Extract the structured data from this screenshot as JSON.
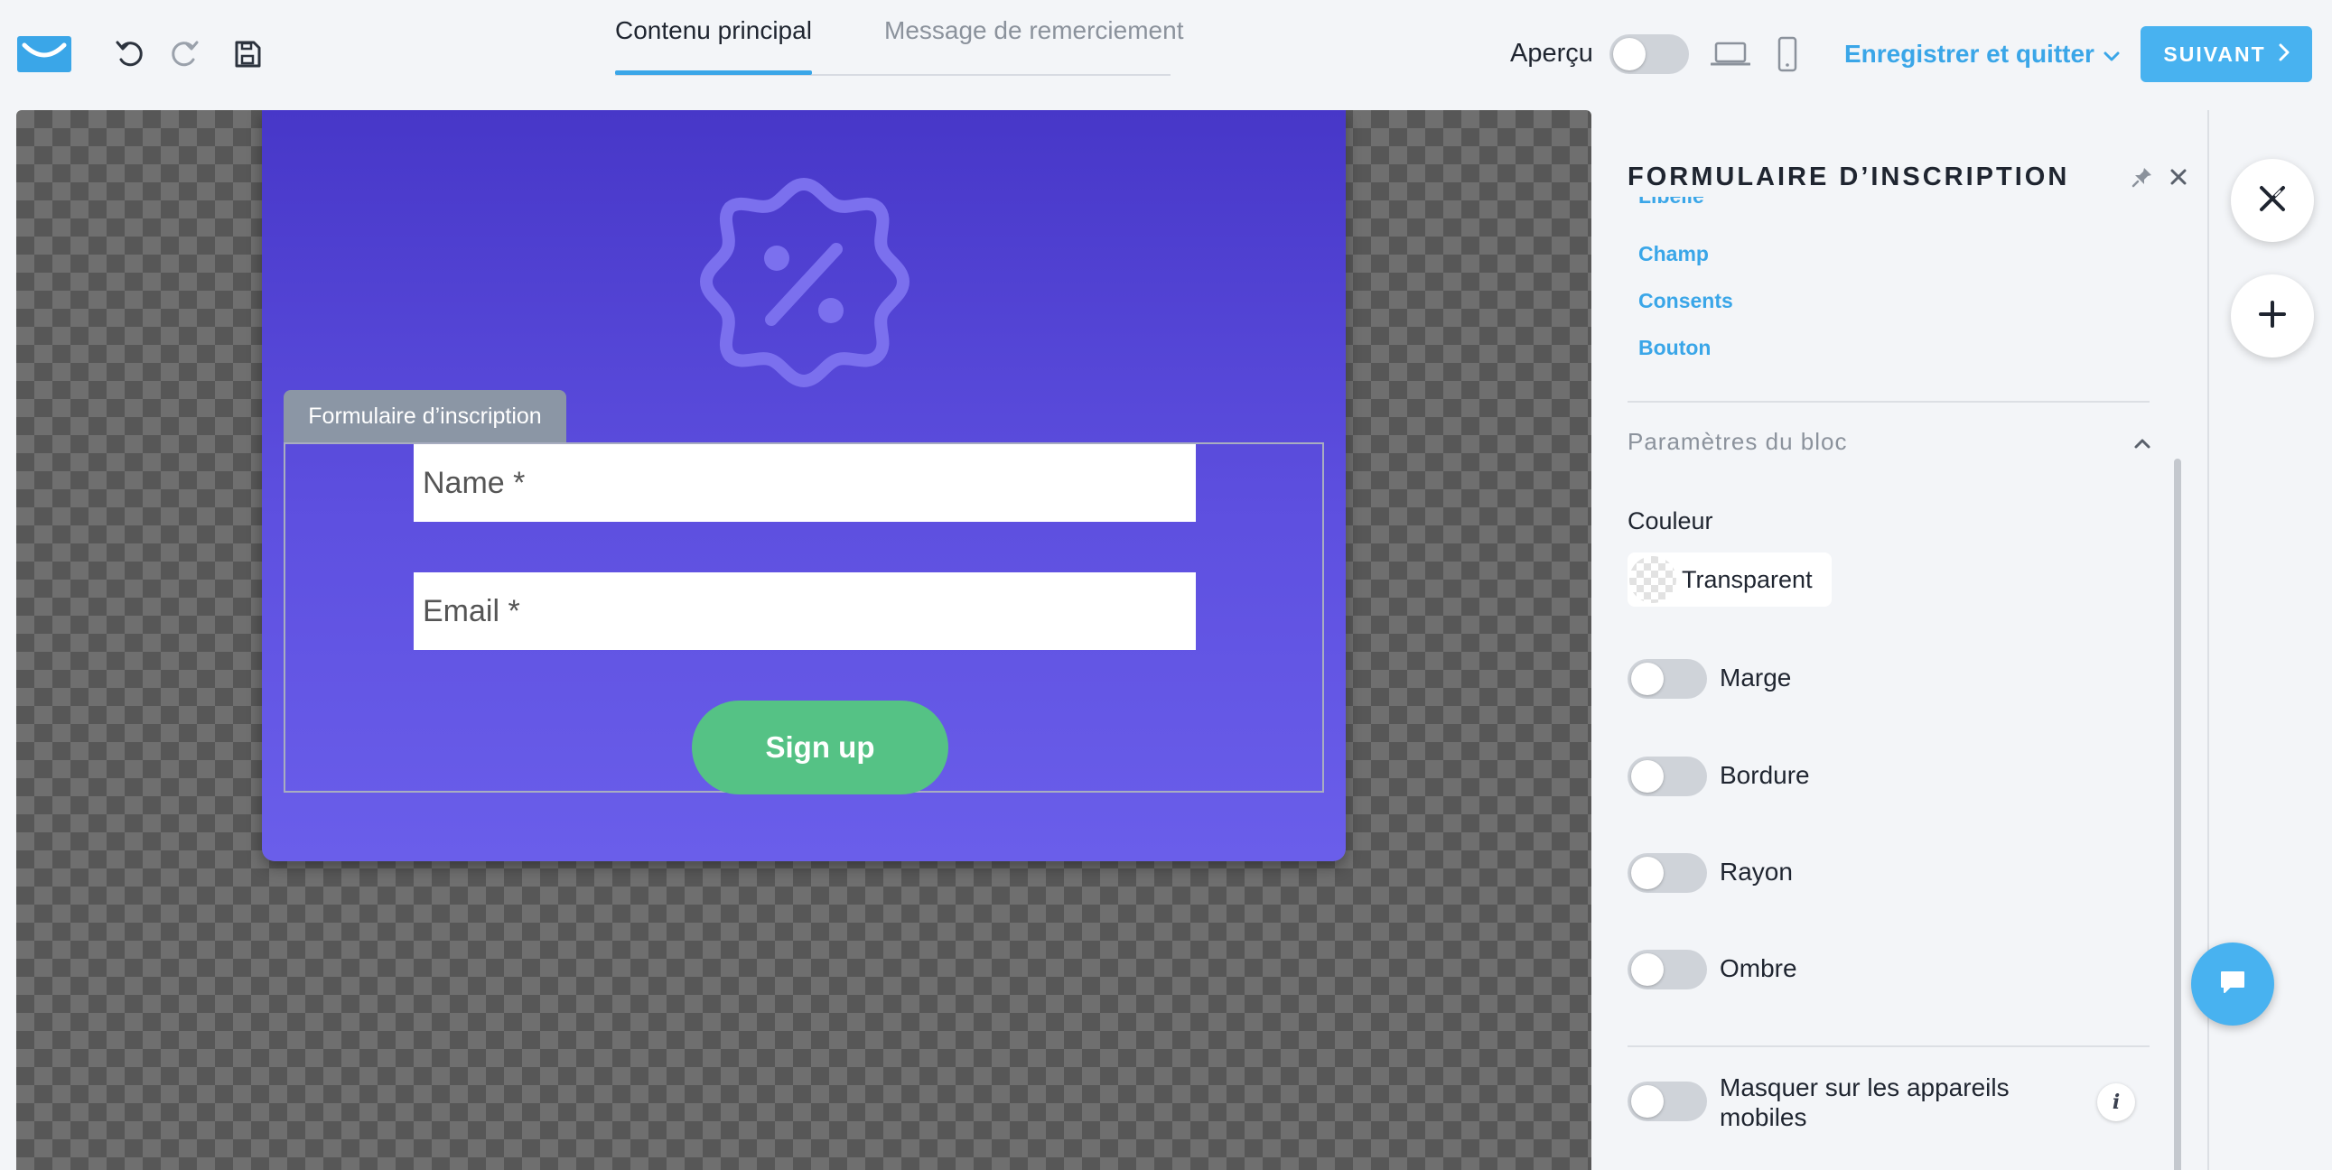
{
  "header": {
    "tabs": [
      {
        "label": "Contenu principal",
        "active": true
      },
      {
        "label": "Message de remerciement",
        "active": false
      }
    ],
    "preview_label": "Aperçu",
    "preview_enabled": false,
    "save_quit_label": "Enregistrer et quitter",
    "next_label": "SUIVANT"
  },
  "popup": {
    "form_tag": "Formulaire d’inscription",
    "name_placeholder": "Name *",
    "email_placeholder": "Email *",
    "signup_label": "Sign up",
    "background_colors": [
      "#4737c8",
      "#6a5eea"
    ],
    "button_color": "#55c285"
  },
  "panel": {
    "title": "FORMULAIRE D’INSCRIPTION",
    "partial_link": "Libellé",
    "links": [
      "Champ",
      "Consents",
      "Bouton"
    ],
    "section_title": "Paramètres du bloc",
    "color_label": "Couleur",
    "color_value": "Transparent",
    "options": [
      {
        "label": "Marge",
        "enabled": false
      },
      {
        "label": "Bordure",
        "enabled": false
      },
      {
        "label": "Rayon",
        "enabled": false
      },
      {
        "label": "Ombre",
        "enabled": false
      }
    ],
    "mobile_hide_label": "Masquer sur les appareils mobiles",
    "mobile_hide_enabled": false
  },
  "colors": {
    "accent": "#3aa6e8",
    "next_button": "#48b2f0",
    "background": "#f3f5f8"
  },
  "icons": {
    "logo": "envelope-logo-icon",
    "undo": "undo-icon",
    "redo": "redo-icon",
    "save": "save-icon",
    "desktop": "laptop-icon",
    "mobile": "phone-icon",
    "badge": "discount-badge-icon",
    "pin": "pin-icon",
    "close": "close-icon",
    "add": "plus-icon",
    "chat": "chat-icon"
  }
}
